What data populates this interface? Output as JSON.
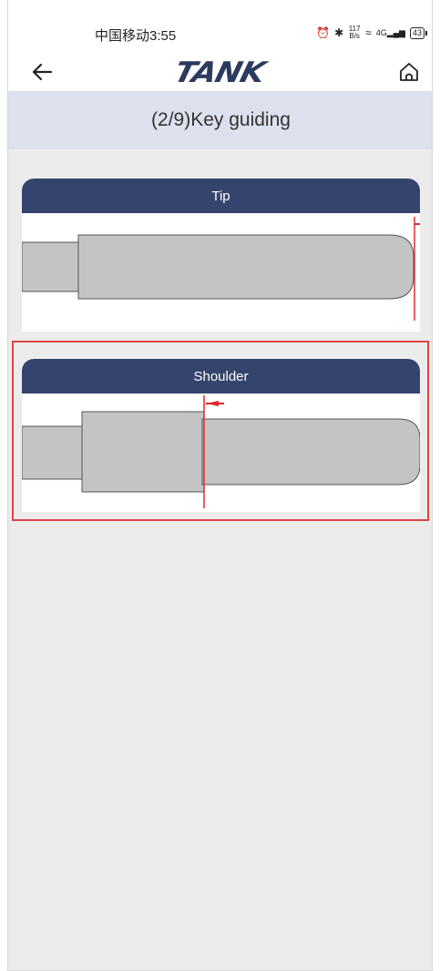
{
  "status_bar": {
    "carrier_time": "中国移动3:55",
    "net_speed_value": "117",
    "net_speed_unit": "B/s",
    "signal_label": "4G",
    "battery": "43"
  },
  "nav": {
    "logo_text": "TANK",
    "back_icon": "arrow-left-icon",
    "home_icon": "home-icon"
  },
  "title": "(2/9)Key guiding",
  "options": [
    {
      "label": "Tip",
      "selected": false
    },
    {
      "label": "Shoulder",
      "selected": true
    }
  ],
  "colors": {
    "header_bg": "#34446c",
    "title_bg": "#dde0ed",
    "marker": "#e02a2a",
    "selection": "#e04444",
    "key_fill": "#c4c4c4"
  }
}
